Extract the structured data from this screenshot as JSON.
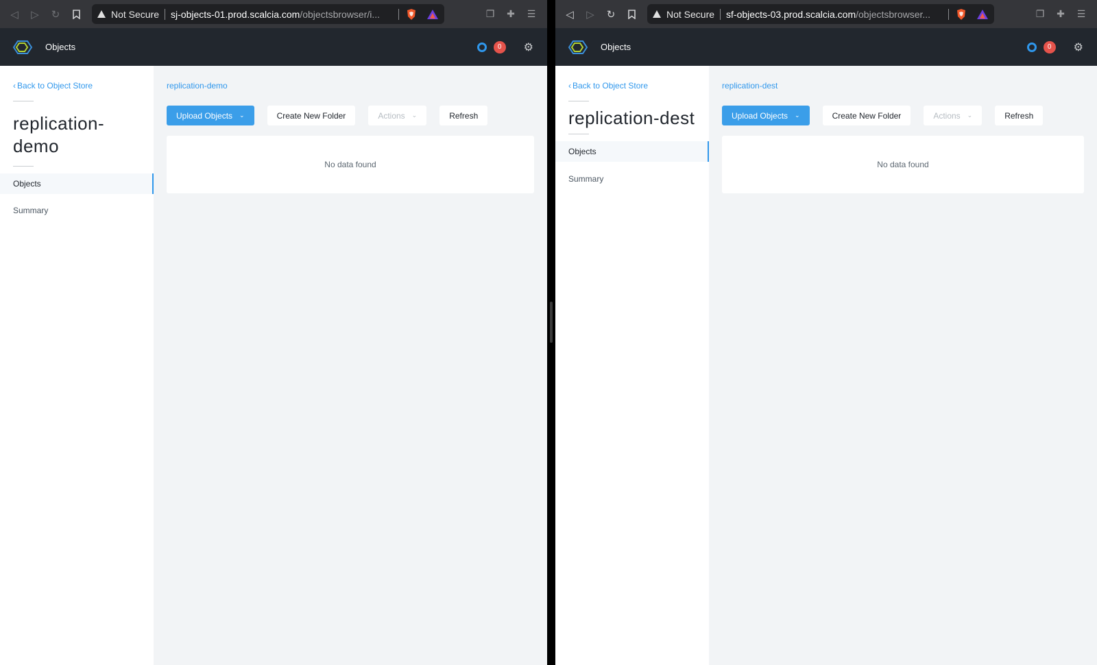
{
  "windows": [
    {
      "id": "left",
      "browser": {
        "not_secure": "Not Secure",
        "url_host": "sj-objects-01.prod.scalcia.com",
        "url_path": "/objectsbrowser/i..."
      },
      "header": {
        "title": "Objects",
        "alert_count": "0"
      },
      "sidebar": {
        "back_link": "Back to Object Store",
        "bucket_title": "replication-demo",
        "items": [
          {
            "label": "Objects",
            "active": true
          },
          {
            "label": "Summary",
            "active": false
          }
        ]
      },
      "main": {
        "breadcrumb": "replication-demo",
        "buttons": {
          "upload": "Upload Objects",
          "create_folder": "Create New Folder",
          "actions": "Actions",
          "refresh": "Refresh"
        },
        "empty_message": "No data found"
      }
    },
    {
      "id": "right",
      "browser": {
        "not_secure": "Not Secure",
        "url_host": "sf-objects-03.prod.scalcia.com",
        "url_path": "/objectsbrowser..."
      },
      "header": {
        "title": "Objects",
        "alert_count": "0"
      },
      "sidebar": {
        "back_link": "Back to Object Store",
        "bucket_title": "replication-dest",
        "items": [
          {
            "label": "Objects",
            "active": true
          },
          {
            "label": "Summary",
            "active": false
          }
        ]
      },
      "main": {
        "breadcrumb": "replication-dest",
        "buttons": {
          "upload": "Upload Objects",
          "create_folder": "Create New Folder",
          "actions": "Actions",
          "refresh": "Refresh"
        },
        "empty_message": "No data found"
      }
    }
  ],
  "colors": {
    "accent": "#2f97ec",
    "header_bg": "#22272e",
    "browser_bg": "#35363a",
    "badge": "#e5534b",
    "content_bg": "#f2f4f6"
  },
  "icons": {
    "browser_nav": [
      "back-icon",
      "forward-icon",
      "reload-icon",
      "bookmark-icon"
    ],
    "address": [
      "warning-icon",
      "brave-shields-icon",
      "brave-rewards-icon"
    ],
    "extensions": [
      "extension-docs-icon",
      "puzzle-icon",
      "menu-icon"
    ],
    "app": [
      "nutanix-logo",
      "status-circle-icon",
      "gear-icon"
    ]
  }
}
